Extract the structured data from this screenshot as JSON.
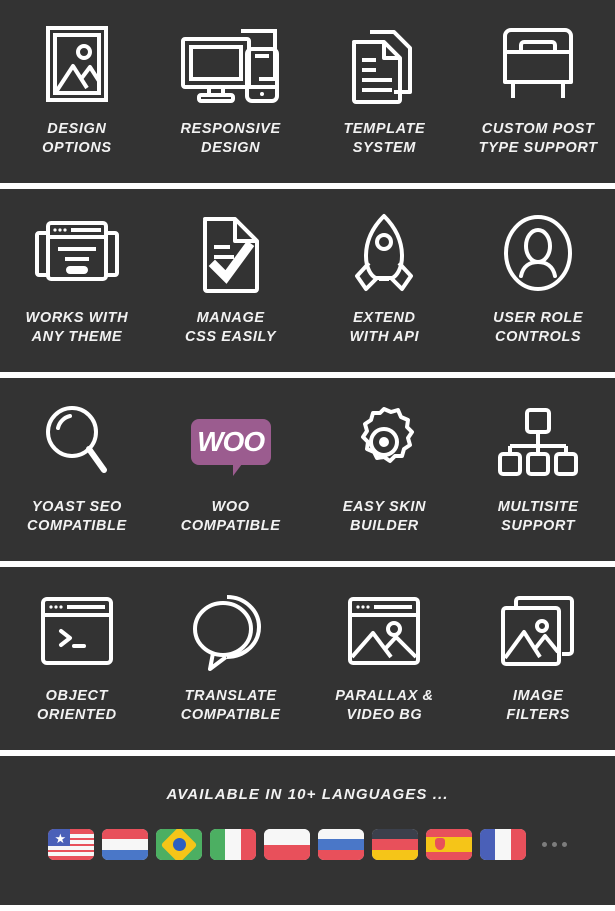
{
  "theme": {
    "panel_bg": "#333333",
    "page_bg": "#ffffff",
    "text_color": "#f2f2f2",
    "icon_color": "#ffffff",
    "woo_purple": "#9b5c8f",
    "dot_color": "#7d7d7d"
  },
  "rows": [
    {
      "cells": [
        {
          "label": "DESIGN\nOPTIONS",
          "icon": "image-frame-icon"
        },
        {
          "label": "RESPONSIVE\nDESIGN",
          "icon": "monitor-phone-icon"
        },
        {
          "label": "TEMPLATE\nSYSTEM",
          "icon": "documents-icon"
        },
        {
          "label": "CUSTOM POST\nTYPE SUPPORT",
          "icon": "archive-box-icon"
        }
      ]
    },
    {
      "cells": [
        {
          "label": "WORKS WITH\nANY THEME",
          "icon": "browser-windows-icon"
        },
        {
          "label": "MANAGE\nCSS EASILY",
          "icon": "document-check-icon"
        },
        {
          "label": "EXTEND\nWITH API",
          "icon": "rocket-icon"
        },
        {
          "label": "USER ROLE\nCONTROLS",
          "icon": "user-circle-icon"
        }
      ]
    },
    {
      "cells": [
        {
          "label": "YOAST SEO\nCOMPATIBLE",
          "icon": "magnifier-icon"
        },
        {
          "label": "WOO\nCOMPATIBLE",
          "icon": "woo-logo-icon",
          "badge_text": "WOO"
        },
        {
          "label": "EASY SKIN\nBUILDER",
          "icon": "gear-icon"
        },
        {
          "label": "MULTISITE\nSUPPORT",
          "icon": "sitemap-icon"
        }
      ]
    },
    {
      "cells": [
        {
          "label": "OBJECT\nORIENTED",
          "icon": "terminal-window-icon"
        },
        {
          "label": "TRANSLATE\nCOMPATIBLE",
          "icon": "speech-bubbles-icon"
        },
        {
          "label": "PARALLAX &\nVIDEO BG",
          "icon": "browser-image-icon"
        },
        {
          "label": "IMAGE\nFILTERS",
          "icon": "image-stack-icon"
        }
      ]
    }
  ],
  "languages": {
    "title": "AVAILABLE IN 10+ LANGUAGES ...",
    "flags": [
      {
        "name": "flag-united-states",
        "code": "us"
      },
      {
        "name": "flag-netherlands",
        "code": "nl"
      },
      {
        "name": "flag-brazil",
        "code": "br"
      },
      {
        "name": "flag-italy",
        "code": "it"
      },
      {
        "name": "flag-poland",
        "code": "pl"
      },
      {
        "name": "flag-russia",
        "code": "ru"
      },
      {
        "name": "flag-germany",
        "code": "de"
      },
      {
        "name": "flag-spain",
        "code": "es"
      },
      {
        "name": "flag-france",
        "code": "fr"
      }
    ],
    "more_indicator": "..."
  }
}
